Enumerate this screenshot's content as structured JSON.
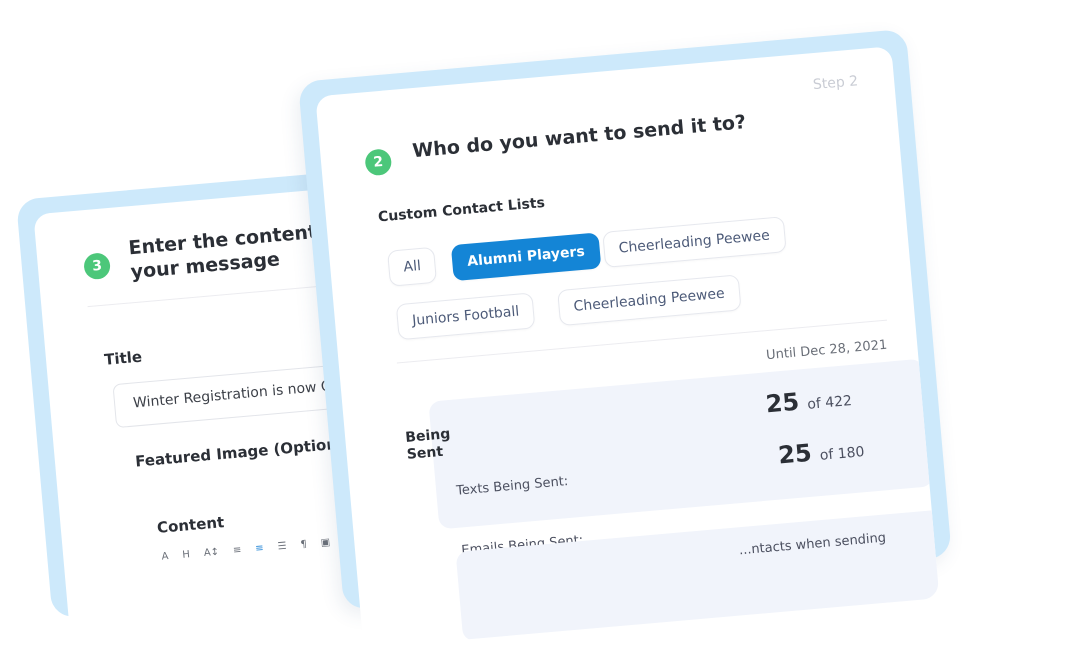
{
  "step3": {
    "number": "3",
    "heading": "Enter the contents of your message",
    "title_label": "Title",
    "title_value": "Winter Registration is now OPEN!",
    "featured_label": "Featured Image (Optional)",
    "content_label": "Content",
    "toolbar": [
      "A",
      "H",
      "A↕",
      "≡",
      "≡",
      "☰",
      "¶",
      "▣"
    ]
  },
  "step2": {
    "step_label": "Step 2",
    "number": "2",
    "heading": "Who do you want to send it to?",
    "lists_label": "Custom Contact Lists",
    "chips": [
      "All",
      "Alumni Players",
      "Cheerleading Peewee",
      "Juniors Football",
      "Cheerleading Peewee"
    ],
    "selected_chip": "Alumni Players",
    "until": "Until Dec 28, 2021",
    "being_sent_label": "Being Sent",
    "texts_label": "Texts Being Sent:",
    "texts_count": "25",
    "texts_total": "of 422",
    "emails_label": "Emails  Being Sent:",
    "emails_count": "25",
    "emails_total": "of 180",
    "footnote": "...ntacts when sending"
  },
  "colors": {
    "accent": "#1485d6",
    "step_dot": "#4cc77a",
    "frame": "#cde9fb",
    "stats_bg": "#f1f4fb"
  }
}
